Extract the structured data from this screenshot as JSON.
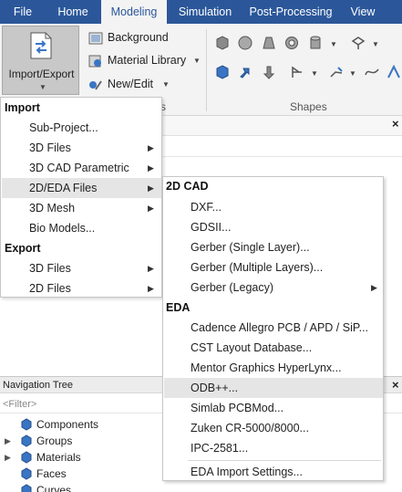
{
  "ribbon": {
    "tabs": [
      {
        "label": "File"
      },
      {
        "label": "Home"
      },
      {
        "label": "Modeling",
        "active": true
      },
      {
        "label": "Simulation"
      },
      {
        "label": "Post-Processing"
      },
      {
        "label": "View"
      }
    ],
    "import_export_label": "Import/Export",
    "background_label": "Background",
    "material_library_label": "Material Library",
    "new_edit_label": "New/Edit",
    "group_partial_label": "s",
    "shapes_group_label": "Shapes"
  },
  "nav_tree": {
    "title": "Navigation Tree",
    "filter_placeholder": "<Filter>",
    "items": [
      {
        "label": "Components",
        "expandable": false
      },
      {
        "label": "Groups",
        "expandable": true
      },
      {
        "label": "Materials",
        "expandable": true
      },
      {
        "label": "Faces",
        "expandable": false
      },
      {
        "label": "Curves",
        "expandable": false
      }
    ]
  },
  "import_menu": {
    "import_header": "Import",
    "import_items": [
      {
        "label": "Sub-Project...",
        "submenu": false
      },
      {
        "label": "3D Files",
        "submenu": true
      },
      {
        "label": "3D CAD Parametric",
        "submenu": true
      },
      {
        "label": "2D/EDA Files",
        "submenu": true,
        "highlighted": true
      },
      {
        "label": "3D Mesh",
        "submenu": true
      },
      {
        "label": "Bio Models...",
        "submenu": false
      }
    ],
    "export_header": "Export",
    "export_items": [
      {
        "label": "3D Files",
        "submenu": true
      },
      {
        "label": "2D Files",
        "submenu": true
      }
    ]
  },
  "eda_submenu": {
    "cad_header": "2D CAD",
    "cad_items": [
      {
        "label": "DXF...",
        "submenu": false
      },
      {
        "label": "GDSII...",
        "submenu": false
      },
      {
        "label": "Gerber (Single Layer)...",
        "submenu": false
      },
      {
        "label": "Gerber (Multiple Layers)...",
        "submenu": false
      },
      {
        "label": "Gerber (Legacy)",
        "submenu": true
      }
    ],
    "eda_header": "EDA",
    "eda_items": [
      {
        "label": "Cadence Allegro PCB / APD / SiP...",
        "highlighted": false
      },
      {
        "label": "CST Layout Database...",
        "highlighted": false
      },
      {
        "label": "Mentor Graphics HyperLynx...",
        "highlighted": false
      },
      {
        "label": "ODB++...",
        "highlighted": true
      },
      {
        "label": "Simlab PCBMod...",
        "highlighted": false
      },
      {
        "label": "Zuken CR-5000/8000...",
        "highlighted": false
      },
      {
        "label": "IPC-2581...",
        "highlighted": false
      }
    ],
    "settings_label": "EDA Import Settings..."
  },
  "close_glyph": "×",
  "colors": {
    "tab_bar": "#2b579a",
    "ribbon_bg": "#f3f3f3",
    "highlight": "#e5e5e5",
    "active_button": "#c8c8c8",
    "icon_blue": "#3a75c4"
  }
}
